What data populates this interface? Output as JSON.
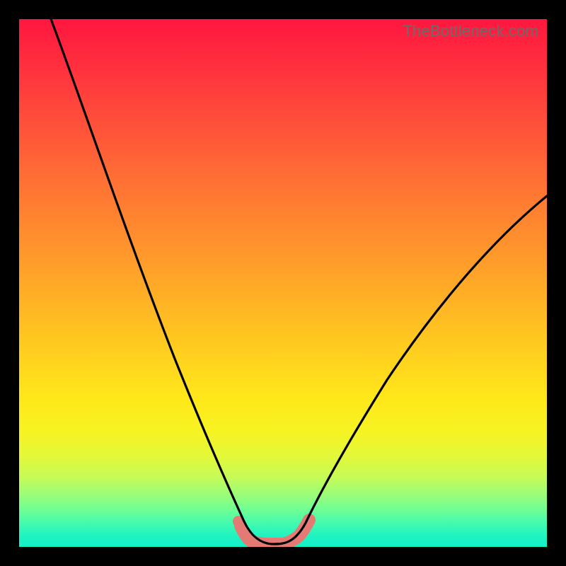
{
  "watermark": "TheBottleneck.com",
  "chart_data": {
    "type": "line",
    "title": "",
    "xlabel": "",
    "ylabel": "",
    "xlim": [
      0,
      100
    ],
    "ylim": [
      0,
      100
    ],
    "series": [
      {
        "name": "bottleneck-curve",
        "x": [
          6,
          10,
          15,
          20,
          25,
          30,
          35,
          38,
          40,
          42,
          44,
          46,
          48,
          50,
          52,
          55,
          60,
          65,
          70,
          75,
          80,
          85,
          90,
          95,
          100
        ],
        "y": [
          100,
          92,
          82,
          72,
          61,
          50,
          36,
          24,
          14,
          6,
          2,
          0.5,
          0.5,
          0.5,
          2,
          6,
          14,
          22,
          30,
          37,
          44,
          50,
          56,
          61,
          66
        ]
      },
      {
        "name": "highlight-band",
        "x": [
          42,
          44,
          46,
          48,
          50,
          52,
          54
        ],
        "y": [
          4,
          1,
          0.5,
          0.5,
          0.5,
          1.5,
          5
        ]
      }
    ],
    "colors": {
      "curve": "#000000",
      "highlight": "#e47a74"
    }
  }
}
